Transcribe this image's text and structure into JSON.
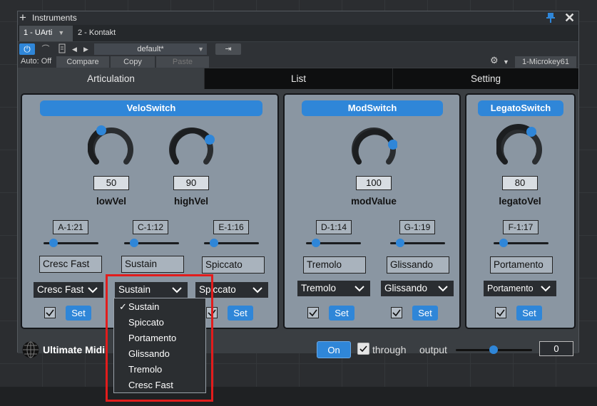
{
  "window": {
    "title": "Instruments",
    "plugin_tabs": [
      {
        "label": "1 - UArti",
        "active": true
      },
      {
        "label": "2 - Kontakt",
        "active": false
      }
    ]
  },
  "toolbar": {
    "preset": "default*",
    "auto_label": "Auto: Off",
    "compare_label": "Compare",
    "copy_label": "Copy",
    "paste_label": "Paste",
    "device": "1-Microkey61"
  },
  "main_tabs": [
    {
      "label": "Articulation",
      "active": true
    },
    {
      "label": "List",
      "active": false
    },
    {
      "label": "Setting",
      "active": false
    }
  ],
  "panels": {
    "velo": {
      "title": "VeloSwitch",
      "knobs": [
        {
          "value": "50",
          "label": "lowVel"
        },
        {
          "value": "90",
          "label": "highVel"
        }
      ],
      "slots": [
        {
          "note": "A-1:21",
          "text": "Cresc Fast",
          "select": "Cresc Fast",
          "set": "Set"
        },
        {
          "note": "C-1:12",
          "text": "Sustain",
          "select": "Sustain",
          "set": "Set"
        },
        {
          "note": "E-1:16",
          "text": "Spiccato",
          "select": "Spiccato",
          "set": "Set"
        }
      ]
    },
    "mod": {
      "title": "ModSwitch",
      "knobs": [
        {
          "value": "100",
          "label": "modValue"
        }
      ],
      "slots": [
        {
          "note": "D-1:14",
          "text": "Tremolo",
          "select": "Tremolo",
          "set": "Set"
        },
        {
          "note": "G-1:19",
          "text": "Glissando",
          "select": "Glissando",
          "set": "Set"
        }
      ]
    },
    "legato": {
      "title": "LegatoSwitch",
      "knobs": [
        {
          "value": "80",
          "label": "legatoVel"
        }
      ],
      "slots": [
        {
          "note": "F-1:17",
          "text": "Portamento",
          "select": "Portamento",
          "set": "Set"
        }
      ]
    }
  },
  "footer": {
    "brand": "Ultimate Midi",
    "on_label": "On",
    "through_label": "through",
    "output_label": "output",
    "output_value": "0"
  },
  "dropdown_menu": {
    "selected": "Sustain",
    "check_mark": "✓",
    "options": [
      "Sustain",
      "Spiccato",
      "Portamento",
      "Glissando",
      "Tremolo",
      "Cresc Fast"
    ]
  },
  "colors": {
    "accent": "#2f86d8",
    "panel": "#8a96a2",
    "highlight": "#e21c1c"
  }
}
